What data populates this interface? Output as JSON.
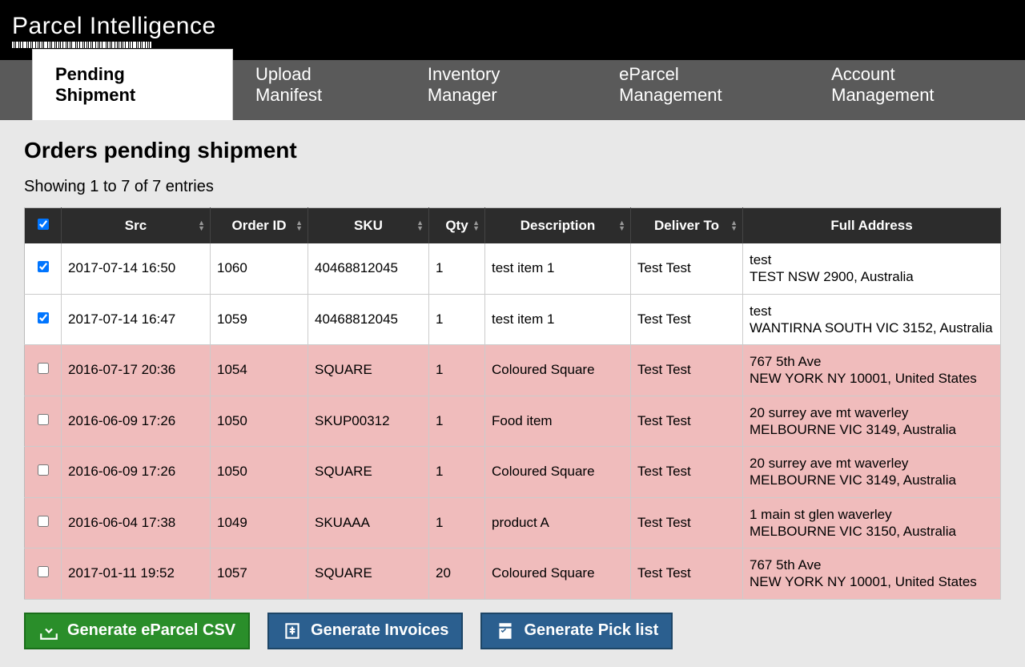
{
  "app": {
    "name": "Parcel Intelligence"
  },
  "nav": {
    "tabs": [
      {
        "label": "Pending Shipment",
        "active": true
      },
      {
        "label": "Upload Manifest",
        "active": false
      },
      {
        "label": "Inventory Manager",
        "active": false
      },
      {
        "label": "eParcel Management",
        "active": false
      },
      {
        "label": "Account Management",
        "active": false
      }
    ]
  },
  "page": {
    "title": "Orders pending shipment",
    "entries_text": "Showing 1 to 7 of 7 entries"
  },
  "table": {
    "headers": {
      "src": "Src",
      "order_id": "Order ID",
      "sku": "SKU",
      "qty": "Qty",
      "description": "Description",
      "deliver_to": "Deliver To",
      "full_address": "Full Address"
    },
    "select_all_checked": true,
    "rows": [
      {
        "checked": true,
        "flagged": false,
        "src": "2017-07-14 16:50",
        "order_id": "1060",
        "sku": "40468812045",
        "qty": "1",
        "description": "test item 1",
        "deliver_to": "Test Test",
        "addr1": "test",
        "addr2": "TEST NSW 2900, Australia"
      },
      {
        "checked": true,
        "flagged": false,
        "src": "2017-07-14 16:47",
        "order_id": "1059",
        "sku": "40468812045",
        "qty": "1",
        "description": "test item 1",
        "deliver_to": "Test Test",
        "addr1": "test",
        "addr2": "WANTIRNA SOUTH VIC 3152, Australia"
      },
      {
        "checked": false,
        "flagged": true,
        "src": "2016-07-17 20:36",
        "order_id": "1054",
        "sku": "SQUARE",
        "qty": "1",
        "description": "Coloured Square",
        "deliver_to": "Test Test",
        "addr1": "767 5th Ave",
        "addr2": "NEW YORK NY 10001, United States"
      },
      {
        "checked": false,
        "flagged": true,
        "src": "2016-06-09 17:26",
        "order_id": "1050",
        "sku": "SKUP00312",
        "qty": "1",
        "description": "Food item",
        "deliver_to": "Test Test",
        "addr1": "20 surrey ave mt waverley",
        "addr2": "MELBOURNE VIC 3149, Australia"
      },
      {
        "checked": false,
        "flagged": true,
        "src": "2016-06-09 17:26",
        "order_id": "1050",
        "sku": "SQUARE",
        "qty": "1",
        "description": "Coloured Square",
        "deliver_to": "Test Test",
        "addr1": "20 surrey ave mt waverley",
        "addr2": "MELBOURNE VIC 3149, Australia"
      },
      {
        "checked": false,
        "flagged": true,
        "src": "2016-06-04 17:38",
        "order_id": "1049",
        "sku": "SKUAAA",
        "qty": "1",
        "description": "product A",
        "deliver_to": "Test Test",
        "addr1": "1 main st glen waverley",
        "addr2": "MELBOURNE VIC 3150, Australia"
      },
      {
        "checked": false,
        "flagged": true,
        "src": "2017-01-11 19:52",
        "order_id": "1057",
        "sku": "SQUARE",
        "qty": "20",
        "description": "Coloured Square",
        "deliver_to": "Test Test",
        "addr1": "767 5th Ave",
        "addr2": "NEW YORK NY 10001, United States"
      }
    ]
  },
  "buttons": {
    "eparcel_csv": "Generate eParcel CSV",
    "invoices": "Generate Invoices",
    "picklist": "Generate Pick list"
  }
}
